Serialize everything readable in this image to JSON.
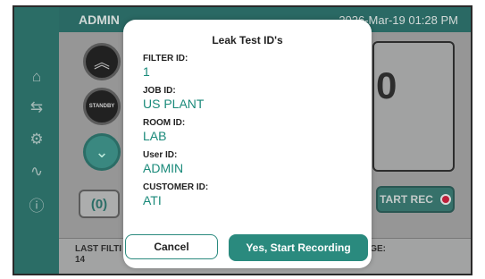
{
  "topbar": {
    "user": "ADMIN",
    "datetime": "2026-Mar-19   01:28 PM"
  },
  "sidebar": {
    "icons": [
      "home-icon",
      "swap-icon",
      "gear-icon",
      "pulse-icon",
      "help-icon"
    ]
  },
  "controls": {
    "standby_label": "STANDBY",
    "zero_label": "(0)",
    "reading_value": "0",
    "start_rec_label": "TART REC"
  },
  "bottom": {
    "last_filter_label": "LAST FILTI",
    "last_filter_value": "14",
    "right_label": "GE:"
  },
  "dialog": {
    "title": "Leak Test ID's",
    "fields": [
      {
        "label": "FILTER ID:",
        "value": "1"
      },
      {
        "label": "JOB ID:",
        "value": "US PLANT"
      },
      {
        "label": "ROOM ID:",
        "value": "LAB"
      },
      {
        "label": "User ID:",
        "value": "ADMIN"
      },
      {
        "label": "CUSTOMER ID:",
        "value": "ATI"
      }
    ],
    "cancel_label": "Cancel",
    "confirm_label": "Yes, Start Recording"
  },
  "colors": {
    "teal": "#2a8a7e",
    "dark_teal": "#1d6a62",
    "record_red": "#c8102e"
  }
}
